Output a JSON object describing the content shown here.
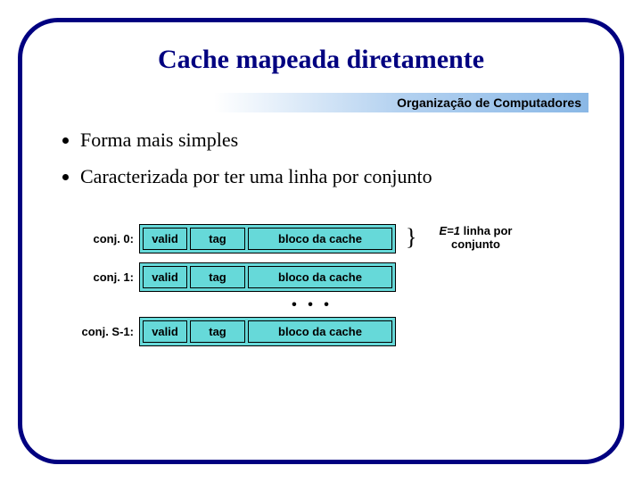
{
  "title": "Cache mapeada diretamente",
  "subtitle": "Organização de Computadores",
  "bullets": [
    "Forma mais simples",
    "Caracterizada por ter uma linha por conjunto"
  ],
  "rows": {
    "r0": {
      "label": "conj. 0:",
      "valid": "valid",
      "tag": "tag",
      "block": "bloco da cache"
    },
    "r1": {
      "label": "conj.  1:",
      "valid": "valid",
      "tag": "tag",
      "block": "bloco da cache"
    },
    "dots": "• • •",
    "rS": {
      "label": "conj.  S-1:",
      "valid": "valid",
      "tag": "tag",
      "block": "bloco da cache"
    }
  },
  "note": {
    "eq": "E=1",
    "rest": " linha por conjunto"
  }
}
